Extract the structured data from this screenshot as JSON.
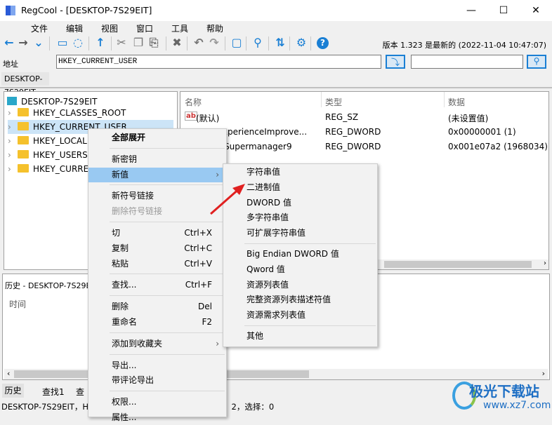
{
  "window": {
    "title": "RegCool - [DESKTOP-7S29EIT]",
    "minimize": "—",
    "maximize": "☐",
    "close": "✕"
  },
  "menubar": [
    "文件",
    "编辑",
    "视图",
    "窗口",
    "工具",
    "帮助"
  ],
  "toolbar": {
    "version": "版本 1.323 是最新的 (2022-11-04 10:47:07)"
  },
  "address": {
    "label": "地址",
    "value": "HKEY_CURRENT_USER",
    "search_value": ""
  },
  "tab": "DESKTOP-7S29EIT",
  "tree": {
    "root": "DESKTOP-7S29EIT",
    "items": [
      "HKEY_CLASSES_ROOT",
      "HKEY_CURRENT_USER",
      "HKEY_LOCAL",
      "HKEY_USERS",
      "HKEY_CURRE"
    ]
  },
  "list": {
    "headers": [
      "名称",
      "类型",
      "数据"
    ],
    "rows": [
      {
        "name": "(默认)",
        "type": "REG_SZ",
        "data": "(未设置值)"
      },
      {
        "name": "erExperienceImprove...",
        "type": "REG_DWORD",
        "data": "0x00000001 (1)"
      },
      {
        "name": "ws_Supermanager9",
        "type": "REG_DWORD",
        "data": "0x001e07a2 (1968034)"
      }
    ]
  },
  "history": {
    "title": "历史 - DESKTOP-7S29EI",
    "column": "时间"
  },
  "bottom_tabs": [
    "历史",
    "查找1",
    "查"
  ],
  "status": {
    "left": "DESKTOP-7S29EIT，H",
    "right": "：2，选择：0"
  },
  "context_menu": [
    {
      "label": "全部展开",
      "bold": true
    },
    {
      "sep": true
    },
    {
      "label": "新密钥"
    },
    {
      "label": "新值",
      "submenu": true,
      "highlight": true
    },
    {
      "sep": true
    },
    {
      "label": "新符号链接"
    },
    {
      "label": "删除符号链接",
      "disabled": true
    },
    {
      "sep": true
    },
    {
      "label": "切",
      "shortcut": "Ctrl+X"
    },
    {
      "label": "复制",
      "shortcut": "Ctrl+C"
    },
    {
      "label": "粘贴",
      "shortcut": "Ctrl+V"
    },
    {
      "sep": true
    },
    {
      "label": "查找...",
      "shortcut": "Ctrl+F"
    },
    {
      "sep": true
    },
    {
      "label": "删除",
      "shortcut": "Del"
    },
    {
      "label": "重命名",
      "shortcut": "F2"
    },
    {
      "sep": true
    },
    {
      "label": "添加到收藏夹",
      "submenu": true
    },
    {
      "sep": true
    },
    {
      "label": "导出..."
    },
    {
      "label": "带评论导出"
    },
    {
      "sep": true
    },
    {
      "label": "权限..."
    },
    {
      "label": "属性..."
    }
  ],
  "submenu": [
    {
      "label": "字符串值"
    },
    {
      "label": "二进制值"
    },
    {
      "label": "DWORD 值"
    },
    {
      "label": "多字符串值"
    },
    {
      "label": "可扩展字符串值"
    },
    {
      "sep": true
    },
    {
      "label": "Big Endian DWORD 值"
    },
    {
      "label": "Qword 值"
    },
    {
      "label": "资源列表值"
    },
    {
      "label": "完整资源列表描述符值"
    },
    {
      "label": "资源需求列表值"
    },
    {
      "sep": true
    },
    {
      "label": "其他"
    }
  ],
  "watermark": {
    "name": "极光下载站",
    "url": "www.xz7.com"
  }
}
